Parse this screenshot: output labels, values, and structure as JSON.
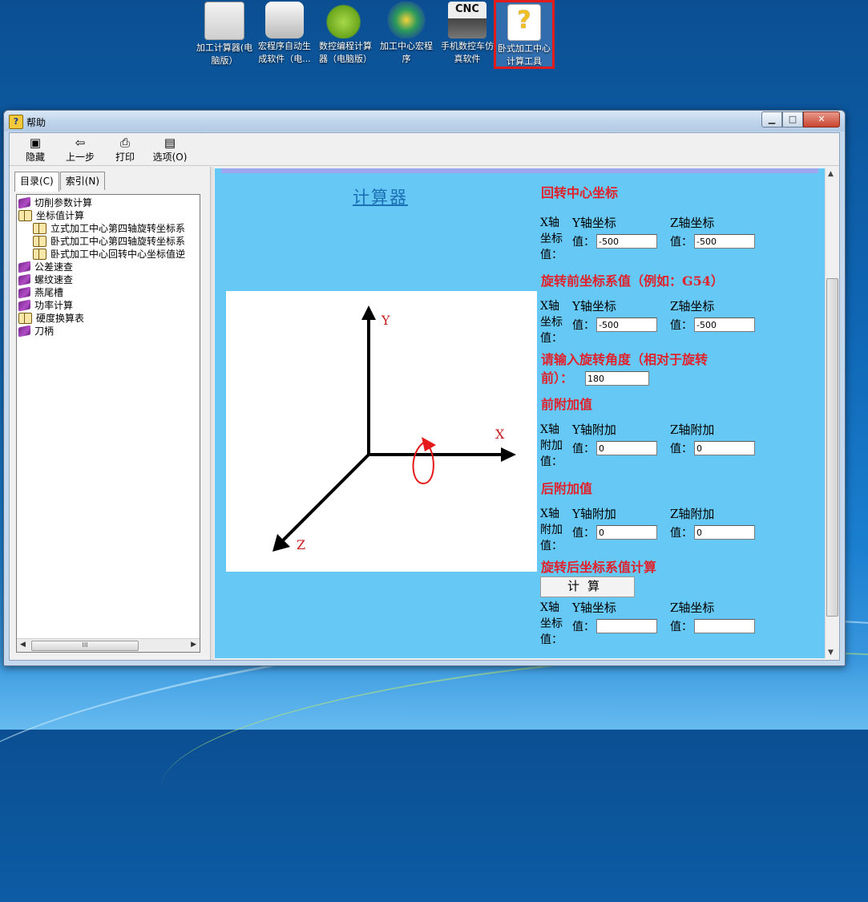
{
  "desktop": {
    "icons": [
      {
        "label": "加工计算器(电脑版）"
      },
      {
        "label": "宏程序自动生成软件（电..."
      },
      {
        "label": "数控编程计算器（电脑版）"
      },
      {
        "label": "加工中心宏程序"
      },
      {
        "label": "手机数控车仿真软件"
      },
      {
        "label": "卧式加工中心计算工具"
      }
    ]
  },
  "window": {
    "title": "帮助",
    "controls": {
      "minimize": "▁",
      "maximize": "□",
      "close": "✕"
    }
  },
  "toolbar": {
    "hide": "隐藏",
    "back": "上一步",
    "print": "打印",
    "options": "选项(O)"
  },
  "nav": {
    "tabs": [
      "目录(C)",
      "索引(N)"
    ],
    "tree": [
      {
        "label": "切削参数计算",
        "type": "closed"
      },
      {
        "label": "坐标值计算",
        "type": "open"
      },
      {
        "label": "立式加工中心第四轴旋转坐标系",
        "type": "page"
      },
      {
        "label": "卧式加工中心第四轴旋转坐标系",
        "type": "page"
      },
      {
        "label": "卧式加工中心回转中心坐标值逆",
        "type": "page"
      },
      {
        "label": "公差速查",
        "type": "closed"
      },
      {
        "label": "螺纹速查",
        "type": "closed"
      },
      {
        "label": "燕尾槽",
        "type": "closed"
      },
      {
        "label": "功率计算",
        "type": "closed"
      },
      {
        "label": "硬度换算表",
        "type": "open"
      },
      {
        "label": "刀柄",
        "type": "closed"
      }
    ],
    "scroll_grip": "III"
  },
  "content": {
    "calc_link": "计算器",
    "axes": {
      "x": "X",
      "y": "Y",
      "z": "Z"
    },
    "sections": {
      "center": "回转中心坐标",
      "pre_coord": "旋转前坐标系值（例如：G54）",
      "angle_prompt_1": "请输入旋转角度（相对于旋转",
      "angle_prompt_2": "前）：",
      "pre_add": "前附加值",
      "post_add": "后附加值",
      "result": "旋转后坐标系值计算"
    },
    "labels": {
      "x_coord": "X轴坐标值：",
      "x_add": "X轴附加值：",
      "y_coord": "Y轴坐标",
      "z_coord": "Z轴坐标",
      "y_add": "Y轴附加",
      "z_add": "Z轴附加",
      "value": "值："
    },
    "values": {
      "center_y": "-500",
      "center_z": "-500",
      "pre_y": "-500",
      "pre_z": "-500",
      "angle": "180",
      "preadd_y": "0",
      "preadd_z": "0",
      "postadd_y": "0",
      "postadd_z": "0",
      "result_y": "",
      "result_z": ""
    },
    "calc_button": "计算"
  },
  "colors": {
    "content_bg": "#66c8f4",
    "heading": "#e1212b",
    "link": "#1b6fb4",
    "selection_border": "#e21b1b"
  }
}
